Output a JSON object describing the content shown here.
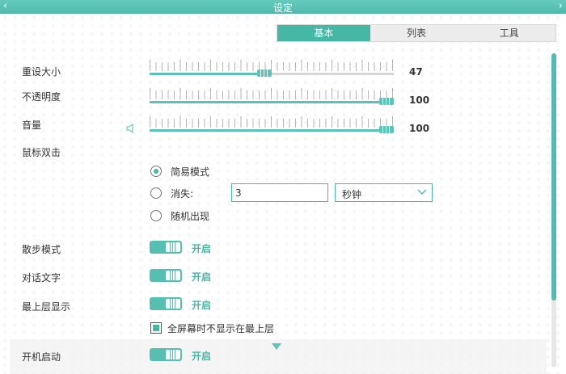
{
  "window": {
    "title": "设定",
    "back_icon": "‹",
    "forward_icon": "›"
  },
  "tabs": [
    {
      "label": "基本",
      "active": true
    },
    {
      "label": "列表",
      "active": false
    },
    {
      "label": "工具",
      "active": false
    }
  ],
  "sliders": {
    "resize": {
      "label": "重设大小",
      "value": 47,
      "value_text": "47"
    },
    "opacity": {
      "label": "不透明度",
      "value": 100,
      "value_text": "100"
    },
    "volume": {
      "label": "音量",
      "value": 100,
      "value_text": "100"
    }
  },
  "double_click": {
    "label": "鼠标双击",
    "options": [
      {
        "label": "简易模式",
        "checked": true
      },
      {
        "label": "消失:",
        "checked": false
      },
      {
        "label": "随机出现",
        "checked": false
      }
    ],
    "disappear_value": "3",
    "unit_select": "秒钟"
  },
  "toggles": [
    {
      "label": "散步模式",
      "state": "开启"
    },
    {
      "label": "对话文字",
      "state": "开启"
    },
    {
      "label": "最上层显示",
      "state": "开启"
    },
    {
      "label": "开机启动",
      "state": "开启"
    }
  ],
  "fullscreen_checkbox": {
    "label": "全屏幕时不显示在最上层",
    "checked": true
  },
  "colors": {
    "accent": "#47b7a5",
    "title_bar": "#56bfb1"
  }
}
